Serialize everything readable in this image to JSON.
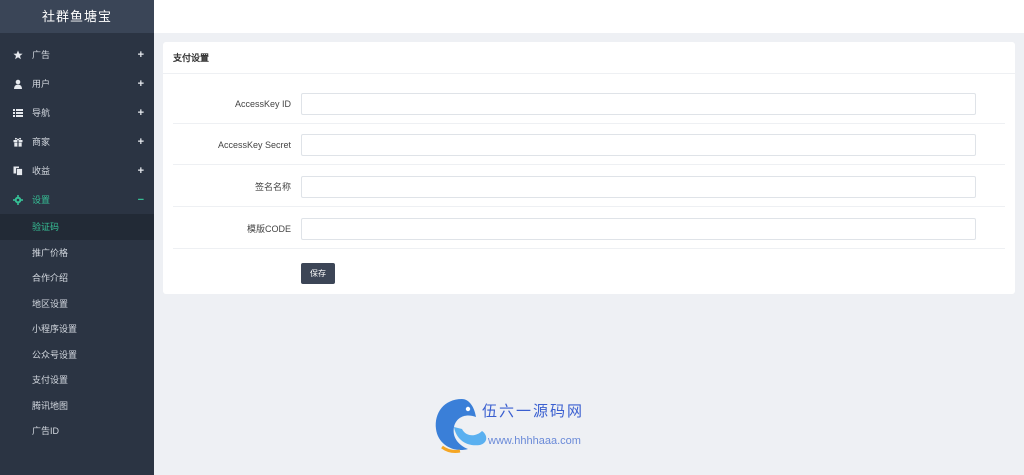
{
  "sidebar": {
    "brand": "社群鱼塘宝",
    "items": [
      {
        "label": "广告",
        "sign": "+",
        "icon": "star-icon"
      },
      {
        "label": "用户",
        "sign": "+",
        "icon": "user-icon"
      },
      {
        "label": "导航",
        "sign": "+",
        "icon": "list-icon"
      },
      {
        "label": "商家",
        "sign": "+",
        "icon": "gift-icon"
      },
      {
        "label": "收益",
        "sign": "+",
        "icon": "copy-icon"
      },
      {
        "label": "设置",
        "sign": "−",
        "icon": "gear-icon"
      }
    ],
    "sub_items": [
      "验证码",
      "推广价格",
      "合作介绍",
      "地区设置",
      "小程序设置",
      "公众号设置",
      "支付设置",
      "腾讯地图",
      "广告ID"
    ],
    "selected_sub": "验证码"
  },
  "panel": {
    "title": "支付设置",
    "fields": [
      {
        "label": "AccessKey ID",
        "value": ""
      },
      {
        "label": "AccessKey Secret",
        "value": ""
      },
      {
        "label": "签名名称",
        "value": ""
      },
      {
        "label": "模版CODE",
        "value": ""
      }
    ],
    "save_label": "保存"
  },
  "watermark": {
    "title": "伍六一源码网",
    "url": "www.hhhhaaa.com"
  },
  "colors": {
    "sidebar_bg": "#2b3443",
    "accent": "#36c096",
    "button_bg": "#3c4556"
  }
}
